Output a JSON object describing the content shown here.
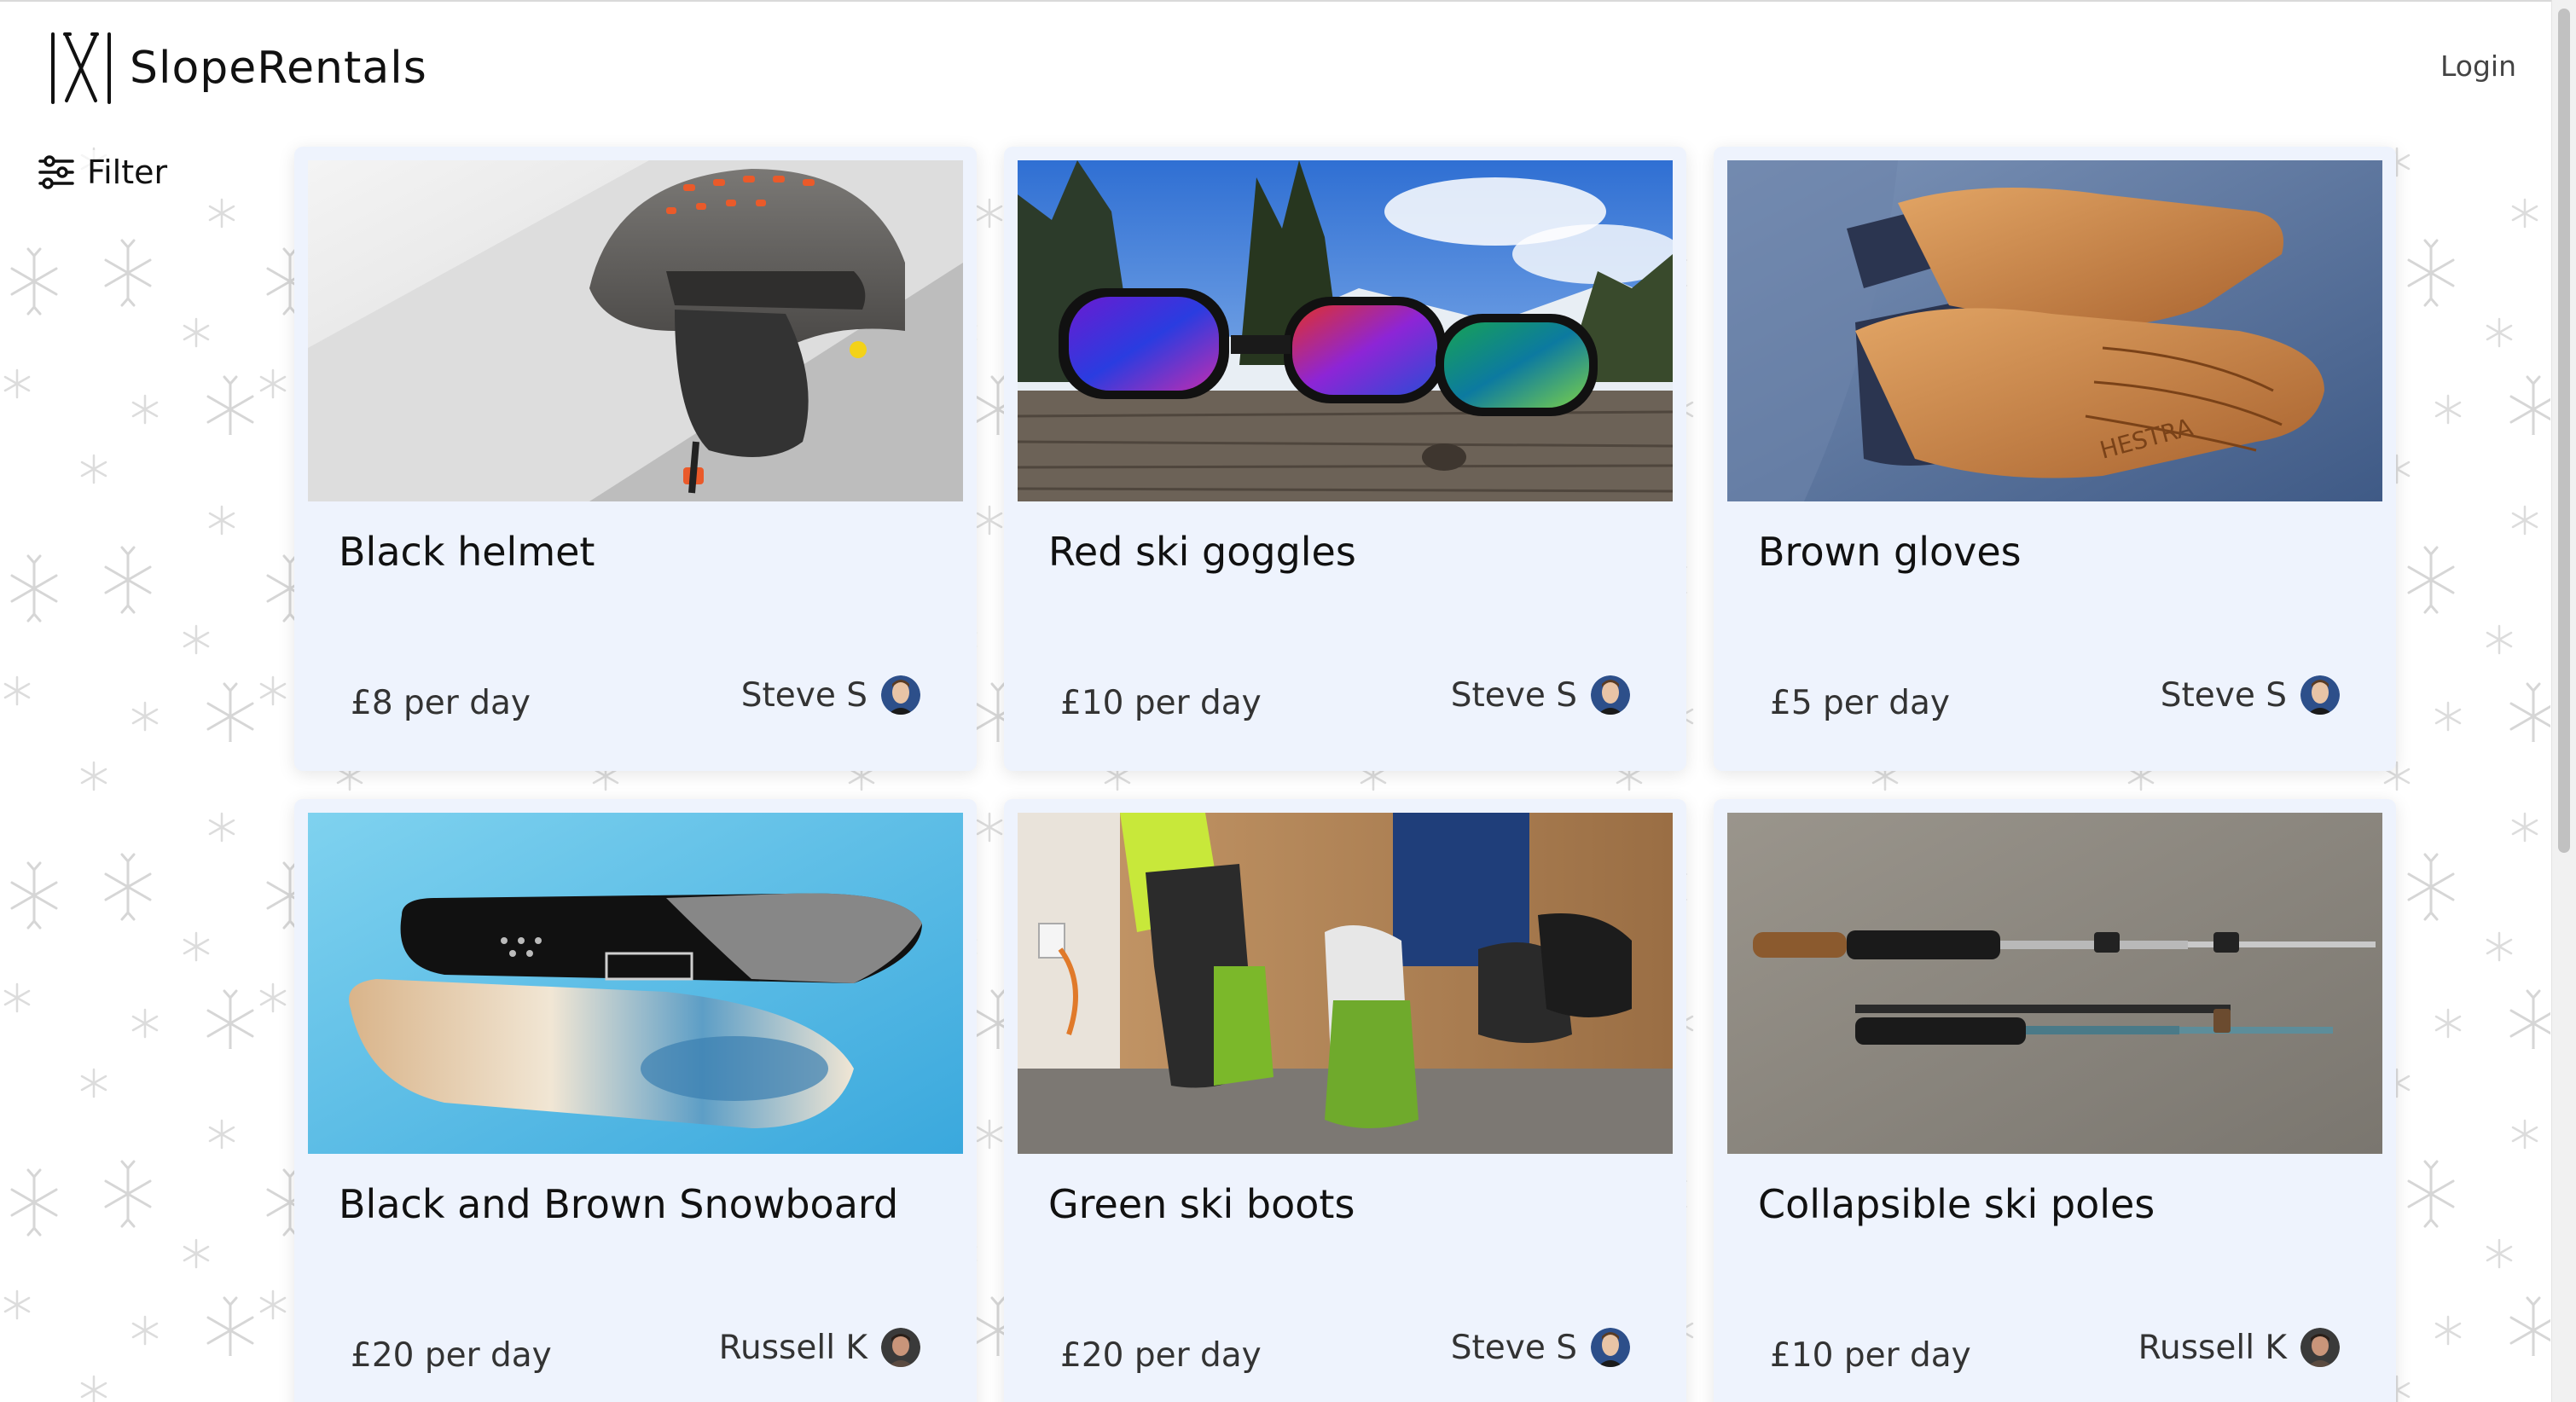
{
  "header": {
    "brand_name": "SlopeRentals",
    "login_label": "Login"
  },
  "filter": {
    "label": "Filter"
  },
  "listings": [
    {
      "title": "Black helmet",
      "price": "£8 per day",
      "owner": "Steve S",
      "image": "helmet"
    },
    {
      "title": "Red ski goggles",
      "price": "£10 per day",
      "owner": "Steve S",
      "image": "goggles"
    },
    {
      "title": "Brown gloves",
      "price": "£5 per day",
      "owner": "Steve S",
      "image": "gloves"
    },
    {
      "title": "Black and Brown Snowboard",
      "price": "£20 per day",
      "owner": "Russell K",
      "image": "snowboard"
    },
    {
      "title": "Green ski boots",
      "price": "£20 per day",
      "owner": "Steve S",
      "image": "boots"
    },
    {
      "title": "Collapsible ski poles",
      "price": "£10 per day",
      "owner": "Russell K",
      "image": "poles"
    }
  ],
  "colors": {
    "card_background": "#eef3fd",
    "page_background": "#ffffff",
    "text": "#111111",
    "muted_text": "#333333"
  },
  "icons": {
    "logo": "crossed-skis-icon",
    "filter": "sliders-icon",
    "owner": "avatar-photo"
  }
}
